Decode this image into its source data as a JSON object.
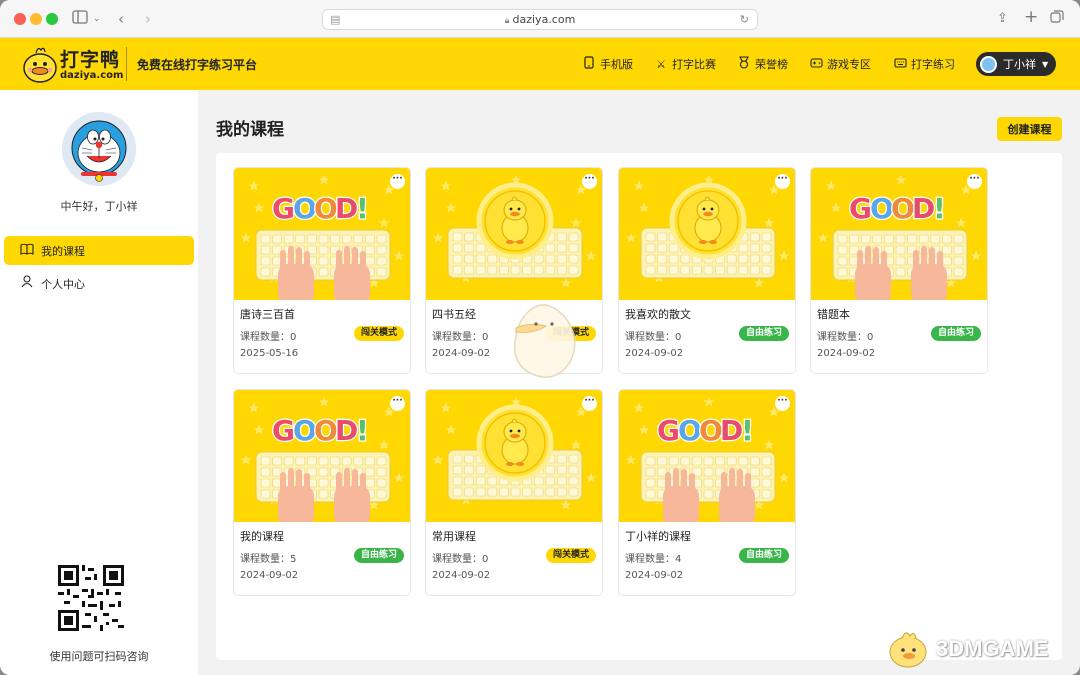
{
  "browser": {
    "url": "daziya.com"
  },
  "header": {
    "logo_name": "打字鸭",
    "logo_domain": "daziya.com",
    "slogan": "免费在线打字练习平台",
    "nav": [
      {
        "label": "手机版",
        "icon": "phone-icon"
      },
      {
        "label": "打字比赛",
        "icon": "crossed-swords-icon"
      },
      {
        "label": "荣誉榜",
        "icon": "medal-icon"
      },
      {
        "label": "游戏专区",
        "icon": "gamepad-icon"
      },
      {
        "label": "打字练习",
        "icon": "keyboard-icon"
      }
    ],
    "user_name": "丁小祥"
  },
  "sidebar": {
    "greeting": "中午好，丁小祥",
    "items": [
      {
        "label": "我的课程",
        "icon": "book-icon",
        "active": true
      },
      {
        "label": "个人中心",
        "icon": "user-icon",
        "active": false
      }
    ],
    "help_text": "使用问题可扫码咨询"
  },
  "main": {
    "title": "我的课程",
    "create_label": "创建课程",
    "count_prefix": "课程数量：",
    "courses": [
      {
        "title": "唐诗三百首",
        "count": "0",
        "date": "2025-05-16",
        "mode": "闯关模式",
        "cover": "good"
      },
      {
        "title": "四书五经",
        "count": "0",
        "date": "2024-09-02",
        "mode": "闯关模式",
        "cover": "duck"
      },
      {
        "title": "我喜欢的散文",
        "count": "0",
        "date": "2024-09-02",
        "mode": "自由练习",
        "cover": "duck"
      },
      {
        "title": "错题本",
        "count": "0",
        "date": "2024-09-02",
        "mode": "自由练习",
        "cover": "good"
      },
      {
        "title": "我的课程",
        "count": "5",
        "date": "2024-09-02",
        "mode": "自由练习",
        "cover": "good"
      },
      {
        "title": "常用课程",
        "count": "0",
        "date": "2024-09-02",
        "mode": "闯关模式",
        "cover": "duck"
      },
      {
        "title": "丁小祥的课程",
        "count": "4",
        "date": "2024-09-02",
        "mode": "自由练习",
        "cover": "good"
      }
    ]
  },
  "watermark": {
    "text": "3DMGAME"
  },
  "colors": {
    "brand_yellow": "#ffd804",
    "free_green": "#3ab54a"
  }
}
